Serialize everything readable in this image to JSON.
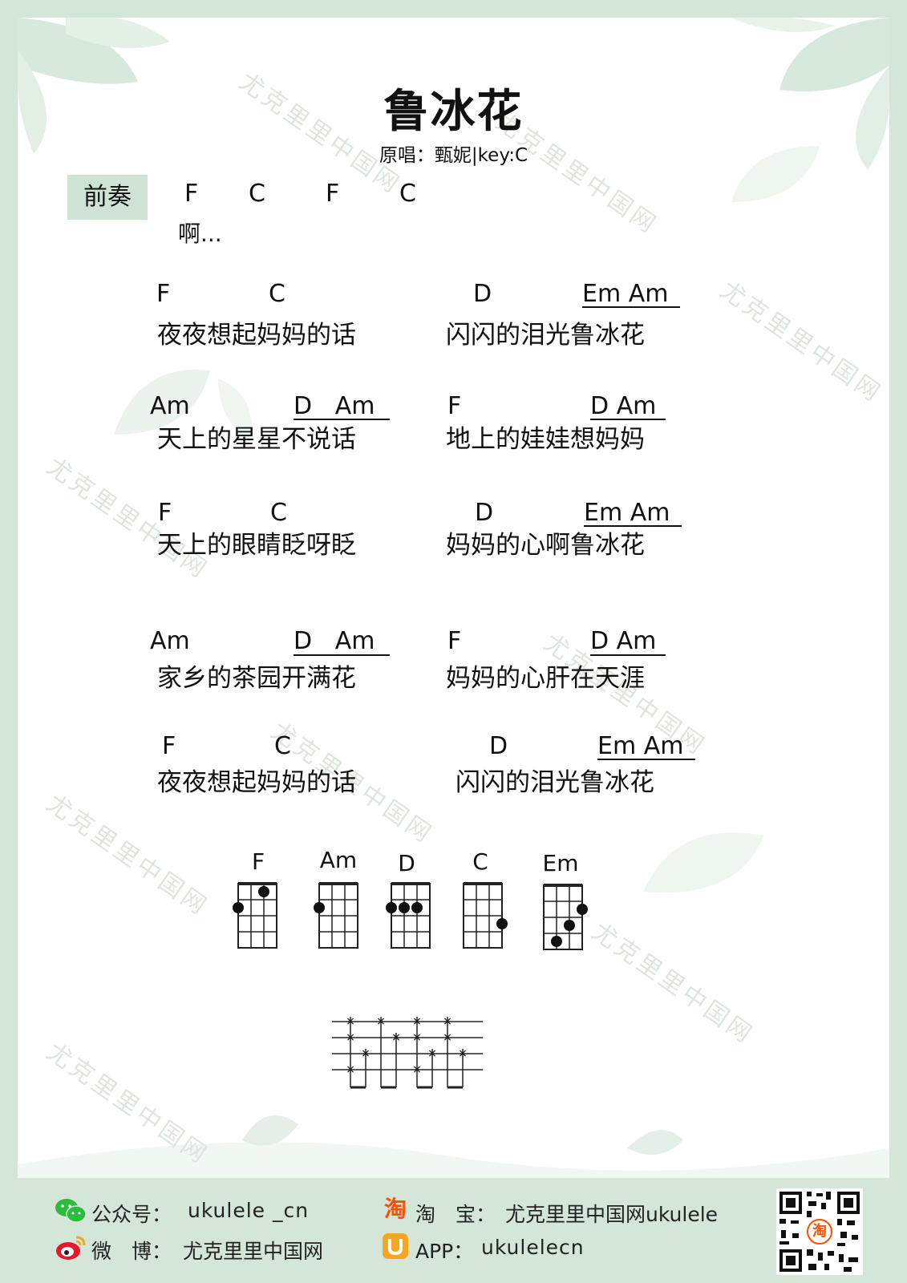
{
  "song": {
    "title": "鲁冰花",
    "subtitle": "原唱：甄妮|key:C"
  },
  "intro": {
    "label": "前奏",
    "chords": [
      "F",
      "C",
      "F",
      "C"
    ],
    "lyric": "啊..."
  },
  "verses": [
    {
      "left_chords": [
        "F",
        "C"
      ],
      "left_lyric": "夜夜想起妈妈的话",
      "right_chords": [
        "D",
        "Em Am"
      ],
      "right_lyric": "闪闪的泪光鲁冰花"
    },
    {
      "left_chords": [
        "Am",
        "D   Am"
      ],
      "left_lyric": "天上的星星不说话",
      "right_chords": [
        "F",
        "D Am"
      ],
      "right_lyric": "地上的娃娃想妈妈"
    },
    {
      "left_chords": [
        "F",
        "C"
      ],
      "left_lyric": "天上的眼睛眨呀眨",
      "right_chords": [
        "D",
        "Em Am"
      ],
      "right_lyric": "妈妈的心啊鲁冰花"
    },
    {
      "left_chords": [
        "Am",
        "D   Am"
      ],
      "left_lyric": "家乡的茶园开满花",
      "right_chords": [
        "F",
        "D Am"
      ],
      "right_lyric": "妈妈的心肝在天涯"
    },
    {
      "left_chords": [
        "F",
        "C"
      ],
      "left_lyric": "夜夜想起妈妈的话",
      "right_chords": [
        "D",
        "Em Am"
      ],
      "right_lyric": "闪闪的泪光鲁冰花"
    }
  ],
  "chord_diagrams": [
    {
      "name": "F",
      "dots": [
        [
          0,
          2
        ],
        [
          2,
          1
        ]
      ]
    },
    {
      "name": "Am",
      "dots": [
        [
          0,
          2
        ]
      ]
    },
    {
      "name": "D",
      "dots": [
        [
          0,
          2
        ],
        [
          1,
          2
        ],
        [
          2,
          2
        ]
      ]
    },
    {
      "name": "C",
      "dots": [
        [
          3,
          3
        ]
      ]
    },
    {
      "name": "Em",
      "dots": [
        [
          1,
          4
        ],
        [
          2,
          3
        ],
        [
          3,
          2
        ]
      ]
    }
  ],
  "strum_pattern": {
    "name": "rhythm-pattern"
  },
  "watermark": "尤克里里中国网",
  "footer": {
    "wechat_label": "公众号：",
    "wechat_value": "ukulele _cn",
    "weibo_label": "微　博：",
    "weibo_value": "尤克里里中国网",
    "taobao_label": "淘　宝：",
    "taobao_value": "尤克里里中国网ukulele",
    "app_label": "APP：",
    "app_value": "ukulelecn",
    "taobao_icon_text": "淘",
    "qr_icon_text": "淘"
  },
  "colors": {
    "frame_green": "#d3e6d8",
    "intro_box": "#cfe3d4",
    "wechat": "#2dbb3b",
    "weibo": "#e6162d",
    "taobao": "#ff5000",
    "app": "#f5a623"
  }
}
